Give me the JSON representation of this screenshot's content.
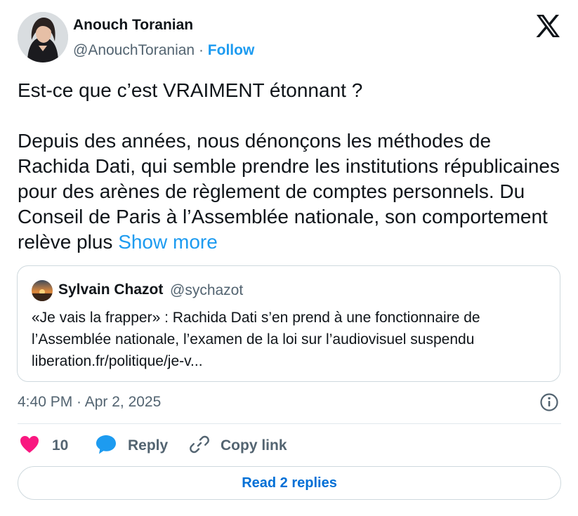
{
  "author": {
    "name": "Anouch Toranian",
    "handle": "@AnouchToranian",
    "separator": "·",
    "follow_label": "Follow"
  },
  "tweet": {
    "lines_1": "Est-ce que c’est VRAIMENT étonnant ?",
    "lines_2": "Depuis des années, nous dénonçons les méthodes de Rachida Dati, qui semble prendre les institutions républicaines pour des arènes de règlement de comptes personnels. Du Conseil de Paris à l’Assemblée nationale, son comportement relève plus",
    "show_more": "Show more"
  },
  "quote": {
    "name": "Sylvain Chazot",
    "handle": "@sychazot",
    "line1": "«Je vais la frapper» : Rachida Dati s’en prend à une fonctionnaire de",
    "line2": "l’Assemblée nationale, l’examen de la loi sur l’audiovisuel suspendu",
    "line3": "liberation.fr/politique/je-v..."
  },
  "meta": {
    "timestamp": "4:40 PM · Apr 2, 2025"
  },
  "actions": {
    "like_count": "10",
    "reply_label": "Reply",
    "copy_label": "Copy link"
  },
  "footer": {
    "read_replies": "Read 2 replies"
  },
  "colors": {
    "accent": "#1d9bf0",
    "heart": "#f91880",
    "text": "#0f1419",
    "secondary": "#536471",
    "border": "#cfd9de"
  },
  "icons": [
    "x-logo-icon",
    "heart-icon",
    "reply-bubble-icon",
    "link-icon",
    "info-icon"
  ]
}
